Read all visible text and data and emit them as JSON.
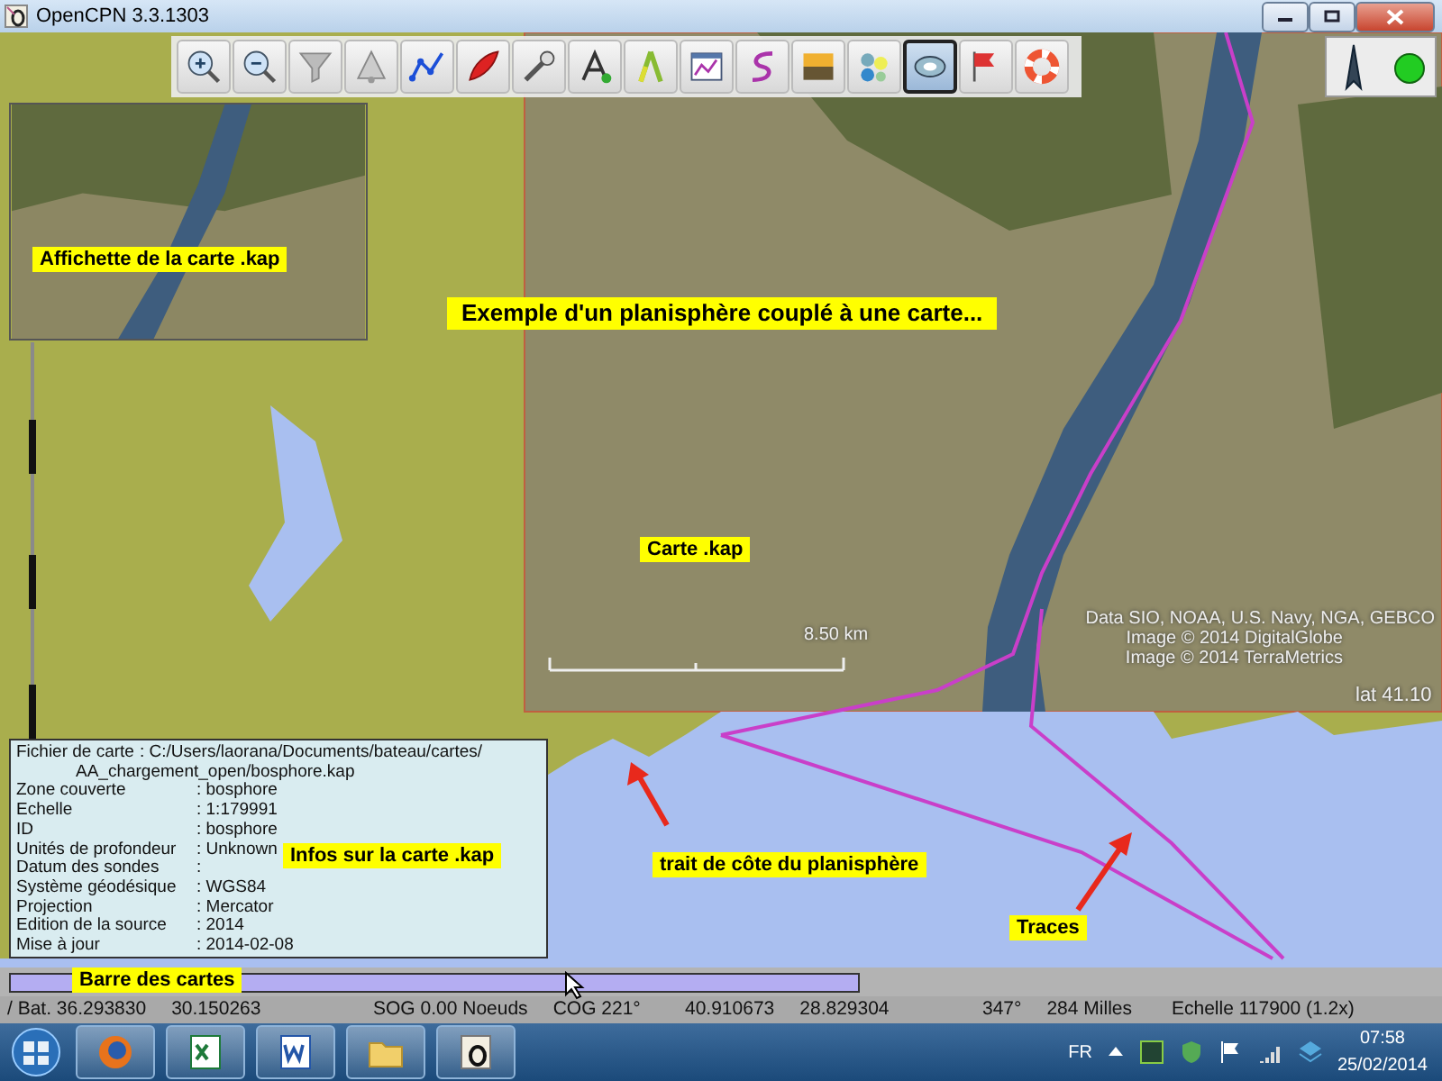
{
  "window": {
    "title": "OpenCPN 3.3.1303"
  },
  "toolbar": {
    "tools": [
      {
        "selected": false
      },
      {
        "selected": false
      },
      {
        "selected": false
      },
      {
        "selected": false
      },
      {
        "selected": false
      },
      {
        "selected": false
      },
      {
        "selected": false
      },
      {
        "selected": false
      },
      {
        "selected": false
      },
      {
        "selected": false
      },
      {
        "selected": false
      },
      {
        "selected": false
      },
      {
        "selected": false
      },
      {
        "selected": true
      },
      {
        "selected": false
      },
      {
        "selected": false
      }
    ]
  },
  "annotations": [
    {
      "text": "Affichette de la carte .kap"
    },
    {
      "text": "Exemple d'un planisphère couplé à une carte..."
    },
    {
      "text": "Carte .kap"
    },
    {
      "text": "Infos sur la carte .kap"
    },
    {
      "text": "trait de côte du planisphère"
    },
    {
      "text": "Traces"
    },
    {
      "text": "Barre des cartes"
    }
  ],
  "chart_overlay": {
    "scale": "8.50  km",
    "attribution": [
      "Data SIO, NOAA, U.S. Navy, NGA, GEBCO",
      "Image © 2014 DigitalGlobe",
      "Image © 2014 TerraMetrics"
    ],
    "position": "lat  41.10"
  },
  "chart_info": {
    "lines": [
      {
        "label": "Fichier de carte",
        "value": ": C:/Users/laorana/Documents/bateau/cartes/",
        "continuation": "AA_chargement_open/bosphore.kap"
      },
      {
        "label": "Zone couverte",
        "value": ": bosphore"
      },
      {
        "label": "Echelle",
        "value": ": 1:179991"
      },
      {
        "label": "ID",
        "value": ": bosphore"
      },
      {
        "label": "Unités de profondeur",
        "value": ": Unknown"
      },
      {
        "label": "Datum des sondes",
        "value": ":"
      },
      {
        "label": "Système géodésique",
        "value": ": WGS84"
      },
      {
        "label": "Projection",
        "value": ": Mercator"
      },
      {
        "label": "Edition de la source",
        "value": ": 2014"
      },
      {
        "label": "Mise à jour",
        "value": ": 2014-02-08"
      }
    ]
  },
  "status_bar": {
    "groups": [
      [
        "/ Bat. 36.293830",
        "30.150263"
      ],
      [
        "SOG 0.00 Noeuds",
        "COG 221°"
      ],
      [
        "40.910673",
        "28.829304"
      ],
      [
        "347°",
        "284 Milles"
      ],
      [
        "Echelle 117900 (1.2x)"
      ]
    ]
  },
  "taskbar": {
    "language": "FR",
    "time": "07:58",
    "date": "25/02/2014"
  }
}
